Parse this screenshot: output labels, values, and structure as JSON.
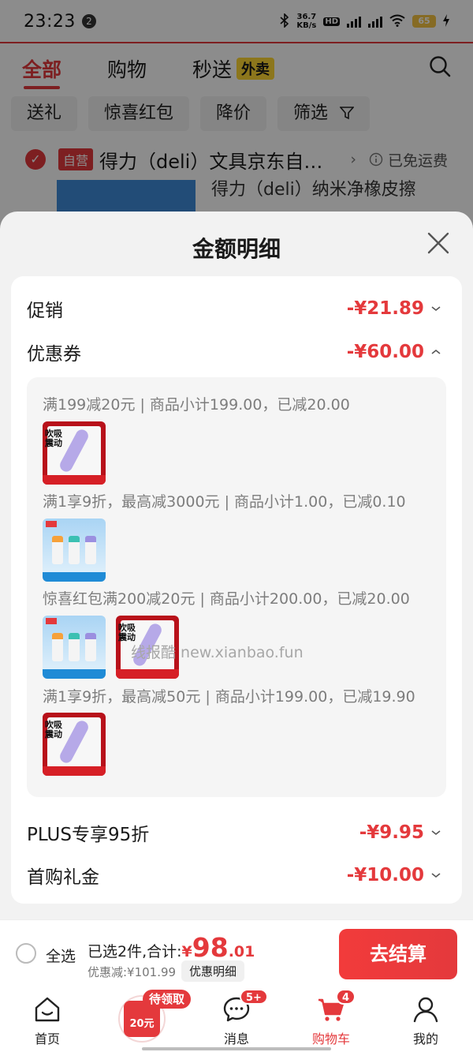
{
  "status": {
    "time": "23:23",
    "notif_count": "2",
    "speed": "36.7\nKB/s",
    "battery": "65"
  },
  "tabs": [
    {
      "label": "全部"
    },
    {
      "label": "购物"
    },
    {
      "label": "秒送"
    }
  ],
  "tab_badge": "外卖",
  "chips": [
    "送礼",
    "惊喜红包",
    "降价",
    "筛选"
  ],
  "shop": {
    "tag": "自营",
    "name": "得力（deli）文具京东自…",
    "shipping": "已免运费",
    "peek_title": "得力（deli）纳米净橡皮擦"
  },
  "sheet": {
    "title": "金额明细",
    "rows": [
      {
        "label": "促销",
        "amount": "-¥21.89"
      },
      {
        "label": "优惠券",
        "amount": "-¥60.00"
      },
      {
        "label": "PLUS专享95折",
        "amount": "-¥9.95"
      },
      {
        "label": "首购礼金",
        "amount": "-¥10.00"
      }
    ],
    "coupons": [
      {
        "text": "满199减20元 | 商品小计199.00，已减20.00"
      },
      {
        "text": "满1享9折，最高减3000元 | 商品小计1.00，已减0.10"
      },
      {
        "text": "惊喜红包满200减20元 | 商品小计200.00，已减20.00"
      },
      {
        "text": "满1享9折，最高减50元 | 商品小计199.00，已减19.90"
      }
    ],
    "watermark": "线报酷 new.xianbao.fun",
    "thumb_text": "吹吸震动"
  },
  "checkout": {
    "select_all": "全选",
    "summary": "已选2件,合计:",
    "yen": "¥",
    "total_int": "98",
    "total_dec": ".01",
    "saved": "优惠减:¥101.99",
    "detail": "优惠明细",
    "pay": "去结算"
  },
  "nav": {
    "home": "首页",
    "promo_pill": "待领取",
    "promo_amount": "20元",
    "messages": "消息",
    "messages_badge": "5+",
    "cart": "购物车",
    "cart_badge": "4",
    "mine": "我的"
  },
  "colors": {
    "accent": "#e4393c",
    "tab_badge": "#ffd833",
    "sheet_bg": "#f2f2f2"
  }
}
